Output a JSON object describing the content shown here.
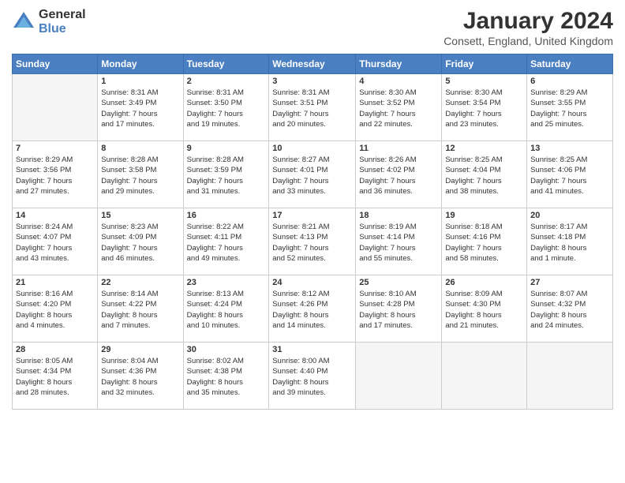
{
  "header": {
    "logo_general": "General",
    "logo_blue": "Blue",
    "title": "January 2024",
    "location": "Consett, England, United Kingdom"
  },
  "weekdays": [
    "Sunday",
    "Monday",
    "Tuesday",
    "Wednesday",
    "Thursday",
    "Friday",
    "Saturday"
  ],
  "weeks": [
    [
      {
        "day": "",
        "info": ""
      },
      {
        "day": "1",
        "info": "Sunrise: 8:31 AM\nSunset: 3:49 PM\nDaylight: 7 hours\nand 17 minutes."
      },
      {
        "day": "2",
        "info": "Sunrise: 8:31 AM\nSunset: 3:50 PM\nDaylight: 7 hours\nand 19 minutes."
      },
      {
        "day": "3",
        "info": "Sunrise: 8:31 AM\nSunset: 3:51 PM\nDaylight: 7 hours\nand 20 minutes."
      },
      {
        "day": "4",
        "info": "Sunrise: 8:30 AM\nSunset: 3:52 PM\nDaylight: 7 hours\nand 22 minutes."
      },
      {
        "day": "5",
        "info": "Sunrise: 8:30 AM\nSunset: 3:54 PM\nDaylight: 7 hours\nand 23 minutes."
      },
      {
        "day": "6",
        "info": "Sunrise: 8:29 AM\nSunset: 3:55 PM\nDaylight: 7 hours\nand 25 minutes."
      }
    ],
    [
      {
        "day": "7",
        "info": "Sunrise: 8:29 AM\nSunset: 3:56 PM\nDaylight: 7 hours\nand 27 minutes."
      },
      {
        "day": "8",
        "info": "Sunrise: 8:28 AM\nSunset: 3:58 PM\nDaylight: 7 hours\nand 29 minutes."
      },
      {
        "day": "9",
        "info": "Sunrise: 8:28 AM\nSunset: 3:59 PM\nDaylight: 7 hours\nand 31 minutes."
      },
      {
        "day": "10",
        "info": "Sunrise: 8:27 AM\nSunset: 4:01 PM\nDaylight: 7 hours\nand 33 minutes."
      },
      {
        "day": "11",
        "info": "Sunrise: 8:26 AM\nSunset: 4:02 PM\nDaylight: 7 hours\nand 36 minutes."
      },
      {
        "day": "12",
        "info": "Sunrise: 8:25 AM\nSunset: 4:04 PM\nDaylight: 7 hours\nand 38 minutes."
      },
      {
        "day": "13",
        "info": "Sunrise: 8:25 AM\nSunset: 4:06 PM\nDaylight: 7 hours\nand 41 minutes."
      }
    ],
    [
      {
        "day": "14",
        "info": "Sunrise: 8:24 AM\nSunset: 4:07 PM\nDaylight: 7 hours\nand 43 minutes."
      },
      {
        "day": "15",
        "info": "Sunrise: 8:23 AM\nSunset: 4:09 PM\nDaylight: 7 hours\nand 46 minutes."
      },
      {
        "day": "16",
        "info": "Sunrise: 8:22 AM\nSunset: 4:11 PM\nDaylight: 7 hours\nand 49 minutes."
      },
      {
        "day": "17",
        "info": "Sunrise: 8:21 AM\nSunset: 4:13 PM\nDaylight: 7 hours\nand 52 minutes."
      },
      {
        "day": "18",
        "info": "Sunrise: 8:19 AM\nSunset: 4:14 PM\nDaylight: 7 hours\nand 55 minutes."
      },
      {
        "day": "19",
        "info": "Sunrise: 8:18 AM\nSunset: 4:16 PM\nDaylight: 7 hours\nand 58 minutes."
      },
      {
        "day": "20",
        "info": "Sunrise: 8:17 AM\nSunset: 4:18 PM\nDaylight: 8 hours\nand 1 minute."
      }
    ],
    [
      {
        "day": "21",
        "info": "Sunrise: 8:16 AM\nSunset: 4:20 PM\nDaylight: 8 hours\nand 4 minutes."
      },
      {
        "day": "22",
        "info": "Sunrise: 8:14 AM\nSunset: 4:22 PM\nDaylight: 8 hours\nand 7 minutes."
      },
      {
        "day": "23",
        "info": "Sunrise: 8:13 AM\nSunset: 4:24 PM\nDaylight: 8 hours\nand 10 minutes."
      },
      {
        "day": "24",
        "info": "Sunrise: 8:12 AM\nSunset: 4:26 PM\nDaylight: 8 hours\nand 14 minutes."
      },
      {
        "day": "25",
        "info": "Sunrise: 8:10 AM\nSunset: 4:28 PM\nDaylight: 8 hours\nand 17 minutes."
      },
      {
        "day": "26",
        "info": "Sunrise: 8:09 AM\nSunset: 4:30 PM\nDaylight: 8 hours\nand 21 minutes."
      },
      {
        "day": "27",
        "info": "Sunrise: 8:07 AM\nSunset: 4:32 PM\nDaylight: 8 hours\nand 24 minutes."
      }
    ],
    [
      {
        "day": "28",
        "info": "Sunrise: 8:05 AM\nSunset: 4:34 PM\nDaylight: 8 hours\nand 28 minutes."
      },
      {
        "day": "29",
        "info": "Sunrise: 8:04 AM\nSunset: 4:36 PM\nDaylight: 8 hours\nand 32 minutes."
      },
      {
        "day": "30",
        "info": "Sunrise: 8:02 AM\nSunset: 4:38 PM\nDaylight: 8 hours\nand 35 minutes."
      },
      {
        "day": "31",
        "info": "Sunrise: 8:00 AM\nSunset: 4:40 PM\nDaylight: 8 hours\nand 39 minutes."
      },
      {
        "day": "",
        "info": ""
      },
      {
        "day": "",
        "info": ""
      },
      {
        "day": "",
        "info": ""
      }
    ]
  ]
}
